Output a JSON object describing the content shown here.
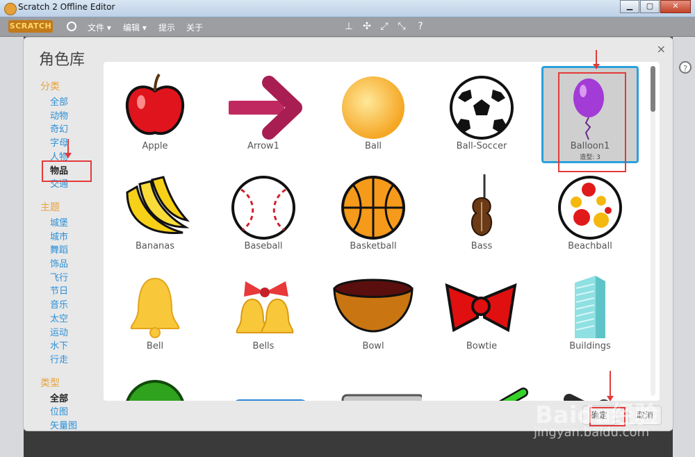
{
  "window": {
    "title": "Scratch 2 Offline Editor",
    "minimize": "▁",
    "maximize": "▢",
    "close": "✕"
  },
  "menubar": {
    "logo": "SCRATCH",
    "file": "文件",
    "edit": "编辑",
    "tips": "提示",
    "about": "关于"
  },
  "library": {
    "title": "角色库",
    "close": "×",
    "category_header": "分类",
    "categories": [
      "全部",
      "动物",
      "奇幻",
      "字母",
      "人物",
      "物品",
      "交通"
    ],
    "theme_header": "主题",
    "themes": [
      "城堡",
      "城市",
      "舞蹈",
      "饰品",
      "飞行",
      "节日",
      "音乐",
      "太空",
      "运动",
      "水下",
      "行走"
    ],
    "type_header": "类型",
    "types": [
      "全部",
      "位图",
      "矢量图"
    ],
    "ok": "确定",
    "cancel": "取消"
  },
  "sprites": [
    {
      "name": "Apple",
      "icon": "apple-icon"
    },
    {
      "name": "Arrow1",
      "icon": "arrow-icon"
    },
    {
      "name": "Ball",
      "icon": "ball-icon"
    },
    {
      "name": "Ball-Soccer",
      "icon": "soccer-ball-icon"
    },
    {
      "name": "Balloon1",
      "icon": "balloon-icon",
      "costumes": "造型: 3"
    },
    {
      "name": "Bananas",
      "icon": "bananas-icon"
    },
    {
      "name": "Baseball",
      "icon": "baseball-icon"
    },
    {
      "name": "Basketball",
      "icon": "basketball-icon"
    },
    {
      "name": "Bass",
      "icon": "bass-icon"
    },
    {
      "name": "Beachball",
      "icon": "beachball-icon"
    },
    {
      "name": "Bell",
      "icon": "bell-icon"
    },
    {
      "name": "Bells",
      "icon": "bells-icon"
    },
    {
      "name": "Bowl",
      "icon": "bowl-icon"
    },
    {
      "name": "Bowtie",
      "icon": "bowtie-icon"
    },
    {
      "name": "Buildings",
      "icon": "buildings-icon"
    }
  ],
  "watermark": {
    "text": "Baidu经验",
    "url": "jingyan.baidu.com"
  },
  "colors": {
    "accent": "#2aa0dc",
    "section": "#e8a23a",
    "link": "#2a8fd8",
    "annotation": "#e23a3a"
  }
}
